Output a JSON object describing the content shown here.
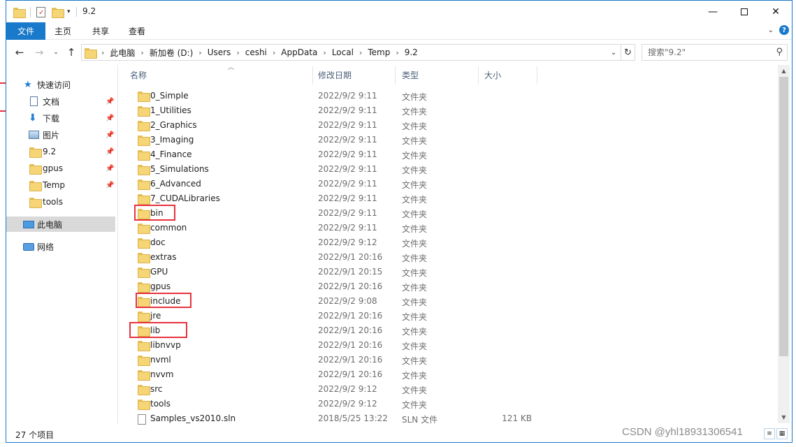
{
  "window": {
    "title": "9.2",
    "minimize_icon": "minimize-icon",
    "maximize_icon": "maximize-icon",
    "close_icon": "close-icon"
  },
  "quick_access_toolbar": {
    "icons": [
      "folder-icon",
      "properties-icon",
      "new-folder-icon",
      "dropdown-icon"
    ]
  },
  "ribbon": {
    "tabs": [
      "文件",
      "主页",
      "共享",
      "查看"
    ],
    "active_tab": "文件",
    "accent": "#1979ca"
  },
  "nav": {
    "back_icon": "arrow-left-icon",
    "forward_icon": "arrow-right-icon",
    "recent_icon": "chevron-down-icon",
    "up_icon": "arrow-up-icon",
    "breadcrumbs": [
      "此电脑",
      "新加卷 (D:)",
      "Users",
      "ceshi",
      "AppData",
      "Local",
      "Temp",
      "9.2"
    ],
    "search_placeholder": "搜索\"9.2\""
  },
  "sidebar": {
    "items": [
      {
        "label": "快速访问",
        "icon": "star-icon"
      },
      {
        "label": "文档",
        "icon": "document-icon",
        "pinned": true
      },
      {
        "label": "下载",
        "icon": "download-icon",
        "pinned": true
      },
      {
        "label": "图片",
        "icon": "picture-icon",
        "pinned": true
      },
      {
        "label": "9.2",
        "icon": "folder-icon",
        "pinned": true
      },
      {
        "label": "gpus",
        "icon": "folder-icon",
        "pinned": true
      },
      {
        "label": "Temp",
        "icon": "folder-icon",
        "pinned": true
      },
      {
        "label": "tools",
        "icon": "folder-icon"
      },
      {
        "label": "此电脑",
        "icon": "computer-icon",
        "selected": true
      },
      {
        "label": "网络",
        "icon": "network-icon"
      }
    ]
  },
  "columns": {
    "name": "名称",
    "modified": "修改日期",
    "type": "类型",
    "size": "大小"
  },
  "files": [
    {
      "name": "0_Simple",
      "date": "2022/9/2 9:11",
      "type": "文件夹",
      "size": ""
    },
    {
      "name": "1_Utilities",
      "date": "2022/9/2 9:11",
      "type": "文件夹",
      "size": ""
    },
    {
      "name": "2_Graphics",
      "date": "2022/9/2 9:11",
      "type": "文件夹",
      "size": ""
    },
    {
      "name": "3_Imaging",
      "date": "2022/9/2 9:11",
      "type": "文件夹",
      "size": ""
    },
    {
      "name": "4_Finance",
      "date": "2022/9/2 9:11",
      "type": "文件夹",
      "size": ""
    },
    {
      "name": "5_Simulations",
      "date": "2022/9/2 9:11",
      "type": "文件夹",
      "size": ""
    },
    {
      "name": "6_Advanced",
      "date": "2022/9/2 9:11",
      "type": "文件夹",
      "size": ""
    },
    {
      "name": "7_CUDALibraries",
      "date": "2022/9/2 9:11",
      "type": "文件夹",
      "size": ""
    },
    {
      "name": "bin",
      "date": "2022/9/2 9:11",
      "type": "文件夹",
      "size": "",
      "highlighted": true
    },
    {
      "name": "common",
      "date": "2022/9/2 9:11",
      "type": "文件夹",
      "size": ""
    },
    {
      "name": "doc",
      "date": "2022/9/2 9:12",
      "type": "文件夹",
      "size": ""
    },
    {
      "name": "extras",
      "date": "2022/9/1 20:16",
      "type": "文件夹",
      "size": ""
    },
    {
      "name": "GPU",
      "date": "2022/9/1 20:15",
      "type": "文件夹",
      "size": ""
    },
    {
      "name": "gpus",
      "date": "2022/9/1 20:16",
      "type": "文件夹",
      "size": ""
    },
    {
      "name": "include",
      "date": "2022/9/2 9:08",
      "type": "文件夹",
      "size": "",
      "highlighted": true
    },
    {
      "name": "jre",
      "date": "2022/9/1 20:16",
      "type": "文件夹",
      "size": ""
    },
    {
      "name": "lib",
      "date": "2022/9/1 20:16",
      "type": "文件夹",
      "size": "",
      "highlighted": true
    },
    {
      "name": "libnvvp",
      "date": "2022/9/1 20:16",
      "type": "文件夹",
      "size": ""
    },
    {
      "name": "nvml",
      "date": "2022/9/1 20:16",
      "type": "文件夹",
      "size": ""
    },
    {
      "name": "nvvm",
      "date": "2022/9/1 20:16",
      "type": "文件夹",
      "size": ""
    },
    {
      "name": "src",
      "date": "2022/9/2 9:12",
      "type": "文件夹",
      "size": ""
    },
    {
      "name": "tools",
      "date": "2022/9/2 9:12",
      "type": "文件夹",
      "size": ""
    },
    {
      "name": "Samples_vs2010.sln",
      "date": "2018/5/25 13:22",
      "type": "SLN 文件",
      "size": "121 KB",
      "is_file": true
    }
  ],
  "highlight_color": "#e8323c",
  "status": {
    "item_count": "27 个项目"
  },
  "watermark": "CSDN @yhl18931306541"
}
